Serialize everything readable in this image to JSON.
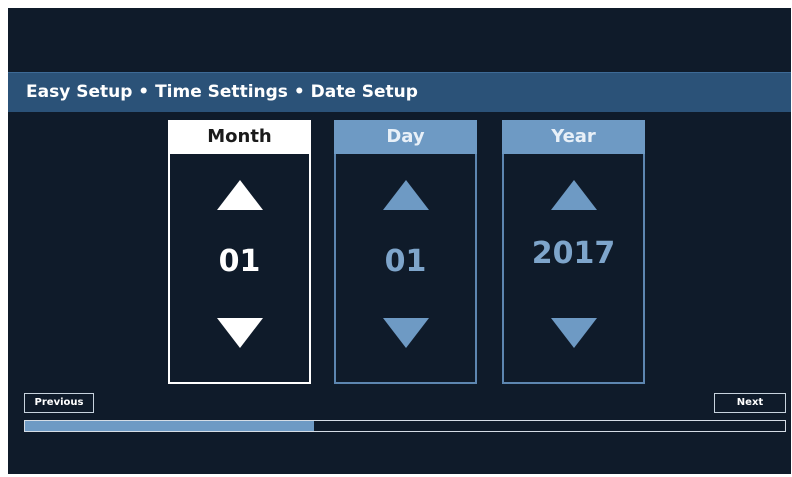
{
  "header": {
    "breadcrumb": "Easy Setup • Time Settings • Date Setup"
  },
  "date_setup": {
    "selected_column": "month",
    "columns": [
      {
        "id": "month",
        "label": "Month",
        "value": "01"
      },
      {
        "id": "day",
        "label": "Day",
        "value": "01"
      },
      {
        "id": "year",
        "label": "Year",
        "value": "2017"
      }
    ]
  },
  "navigation": {
    "previous_label": "Previous",
    "next_label": "Next"
  },
  "progress": {
    "fraction": 0.38
  },
  "colors": {
    "background": "#0f1b2a",
    "title_bar": "#2b5278",
    "accent": "#6e9ac4",
    "selected": "#ffffff"
  },
  "icons": {
    "increment": "triangle-up",
    "decrement": "triangle-down"
  }
}
